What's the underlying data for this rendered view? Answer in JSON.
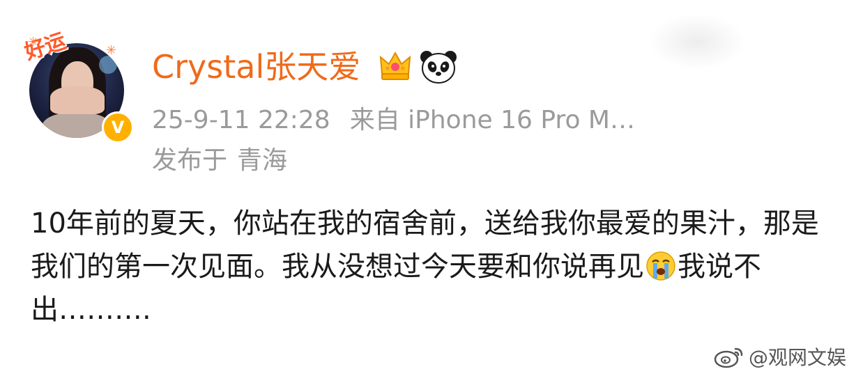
{
  "post": {
    "author": {
      "name": "Crystal张天爱",
      "sticker_text": "好运",
      "verified_badge": "V",
      "badges": [
        "crown-icon",
        "panda-icon"
      ]
    },
    "timestamp": "25-9-11 22:28",
    "source": "来自 iPhone 16 Pro M…",
    "location_label": "发布于",
    "location": "青海",
    "text_part1": "10年前的夏天，你站在我的宿舍前，送给我你最爱的果汁，那是我们的第一次见面。我从没想过今天要和你说再见",
    "emoji": "crying-face",
    "text_part2": "我说不出………."
  },
  "watermark": {
    "text": "@观网文娱",
    "icon": "weibo-icon"
  },
  "colors": {
    "name_orange": "#f06a1a",
    "meta_gray": "#9a9a9a",
    "text_black": "#1a1a1a",
    "badge_gold": "#ffb000"
  }
}
